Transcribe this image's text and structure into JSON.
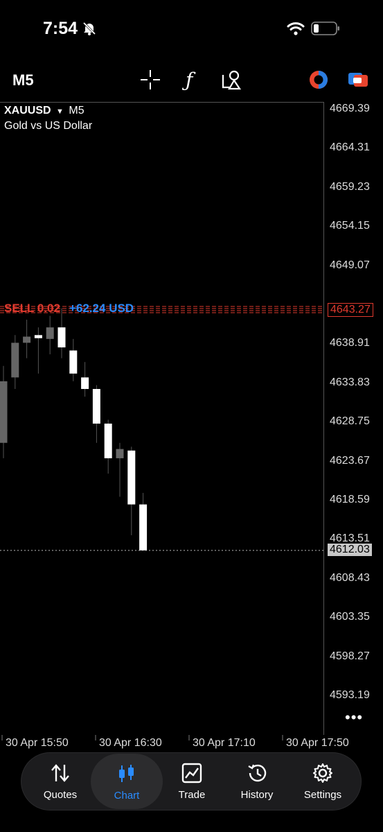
{
  "status_bar": {
    "time": "7:54"
  },
  "toolbar": {
    "timeframe": "M5",
    "icons": [
      "crosshair-icon",
      "function-icon",
      "objects-icon",
      "one-click-trading-icon",
      "account-switch-icon"
    ]
  },
  "chart": {
    "symbol": "XAUUSD",
    "symbol_timeframe": "M5",
    "description": "Gold vs US Dollar",
    "position_label": "SELL 0.02",
    "position_profit": "+62.24 USD",
    "price_labels": [
      "4669.39",
      "4664.31",
      "4659.23",
      "4654.15",
      "4649.07",
      "4638.91",
      "4633.83",
      "4628.75",
      "4623.67",
      "4618.59",
      "4613.51",
      "4608.43",
      "4603.35",
      "4598.27",
      "4593.19"
    ],
    "position_price": "4643.27",
    "current_price": "4612.03",
    "time_labels": [
      "30 Apr 15:50",
      "30 Apr 16:30",
      "30 Apr 17:10",
      "30 Apr 17:50"
    ],
    "colors": {
      "sell_line": "#e03a2e",
      "profit_text": "#2a8cff",
      "bull_candle": "#ffffff",
      "bear_candle": "#666666"
    }
  },
  "chart_data": {
    "type": "candlestick",
    "symbol": "XAUUSD",
    "timeframe": "M5",
    "ylim": [
      4590.5,
      4671
    ],
    "candles": [
      {
        "open": 4626.0,
        "high": 4636.0,
        "low": 4624.0,
        "close": 4634.0
      },
      {
        "open": 4634.5,
        "high": 4640.0,
        "low": 4633.0,
        "close": 4639.0
      },
      {
        "open": 4639.0,
        "high": 4642.0,
        "low": 4637.0,
        "close": 4639.8
      },
      {
        "open": 4640.0,
        "high": 4641.0,
        "low": 4635.0,
        "close": 4639.6
      },
      {
        "open": 4639.5,
        "high": 4642.5,
        "low": 4637.5,
        "close": 4641.0
      },
      {
        "open": 4641.0,
        "high": 4643.5,
        "low": 4637.0,
        "close": 4638.4
      },
      {
        "open": 4638.0,
        "high": 4639.5,
        "low": 4634.0,
        "close": 4635.0
      },
      {
        "open": 4634.5,
        "high": 4636.5,
        "low": 4632.0,
        "close": 4633.0
      },
      {
        "open": 4633.0,
        "high": 4633.5,
        "low": 4626.0,
        "close": 4628.5
      },
      {
        "open": 4628.5,
        "high": 4629.0,
        "low": 4622.0,
        "close": 4624.0
      },
      {
        "open": 4624.0,
        "high": 4626.0,
        "low": 4619.0,
        "close": 4625.2
      },
      {
        "open": 4625.0,
        "high": 4625.5,
        "low": 4614.0,
        "close": 4618.0
      },
      {
        "open": 4618.0,
        "high": 4619.5,
        "low": 4612.03,
        "close": 4612.03
      }
    ],
    "position_line": 4643.27,
    "bid_line": 4612.03,
    "x_tick_labels": [
      "30 Apr 15:50",
      "30 Apr 16:30",
      "30 Apr 17:10",
      "30 Apr 17:50"
    ],
    "grid": false
  },
  "nav": {
    "items": [
      {
        "label": "Quotes",
        "icon": "quotes-arrows-icon"
      },
      {
        "label": "Chart",
        "icon": "candlestick-chart-icon"
      },
      {
        "label": "Trade",
        "icon": "trade-chart-icon"
      },
      {
        "label": "History",
        "icon": "history-clock-icon"
      },
      {
        "label": "Settings",
        "icon": "gear-icon"
      }
    ],
    "active": "Chart",
    "active_color": "#2a8cff"
  }
}
